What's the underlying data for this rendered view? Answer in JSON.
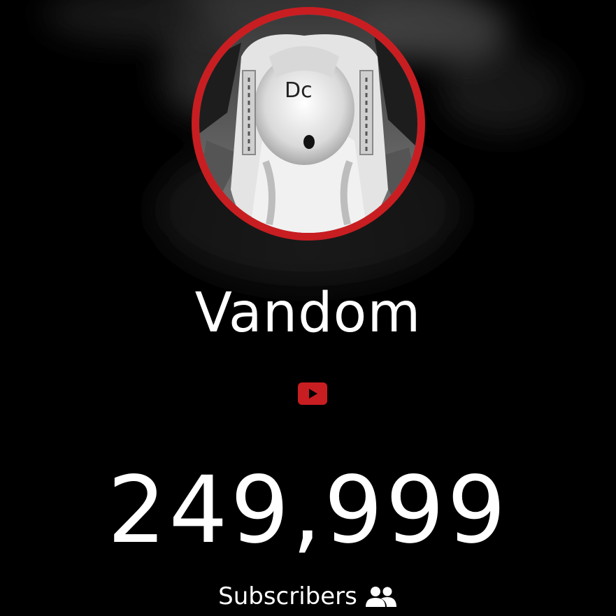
{
  "channel": {
    "name": "Vandom",
    "platform_icon": "youtube-play-icon",
    "accent_color": "#c81e22"
  },
  "subscribers": {
    "count": "249,999",
    "label": "Subscribers",
    "icon": "users-icon"
  },
  "avatar": {
    "description_icon": "channel-avatar"
  }
}
